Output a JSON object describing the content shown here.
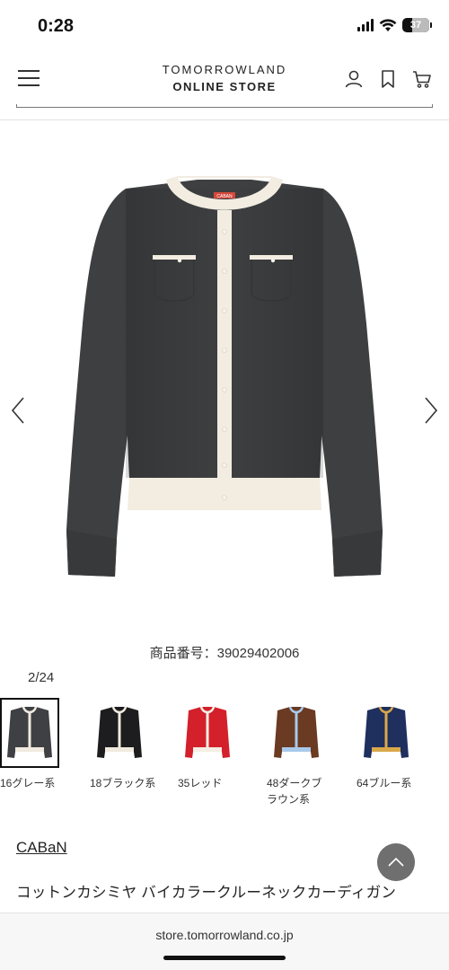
{
  "status_bar": {
    "time": "0:28",
    "battery": "37",
    "battery_level": 0.37,
    "icons": [
      "signal-icon",
      "wifi-icon",
      "battery-icon"
    ]
  },
  "header": {
    "logo_line1": "TOMORROWLAND",
    "logo_line2": "ONLINE STORE",
    "icons": [
      "menu-icon",
      "account-icon",
      "bookmark-icon",
      "cart-icon"
    ]
  },
  "product": {
    "label_text": "CABAN",
    "product_number": "商品番号：39029402006",
    "image_counter": "2/24",
    "brand": "CABaN",
    "name": "コットンカシミヤ バイカラークルーネックカーディガン",
    "body_color": "#3e3f41",
    "trim_color": "#f2ece1"
  },
  "colors": [
    {
      "label": "16グレー系",
      "body": "#3f4043",
      "trim": "#f1eadf",
      "selected": true
    },
    {
      "label": "18ブラック系",
      "body": "#1d1d1f",
      "trim": "#f1eadf",
      "selected": false
    },
    {
      "label": "35レッド",
      "body": "#d3202a",
      "trim": "#f4eee4",
      "selected": false
    },
    {
      "label": "48ダークブラウン系",
      "body": "#6a3a22",
      "trim": "#a9c9ea",
      "selected": false
    },
    {
      "label": "64ブルー系",
      "body": "#1f2f5e",
      "trim": "#d9a84a",
      "selected": false
    }
  ],
  "footer": {
    "url": "store.tomorrowland.co.jp"
  }
}
